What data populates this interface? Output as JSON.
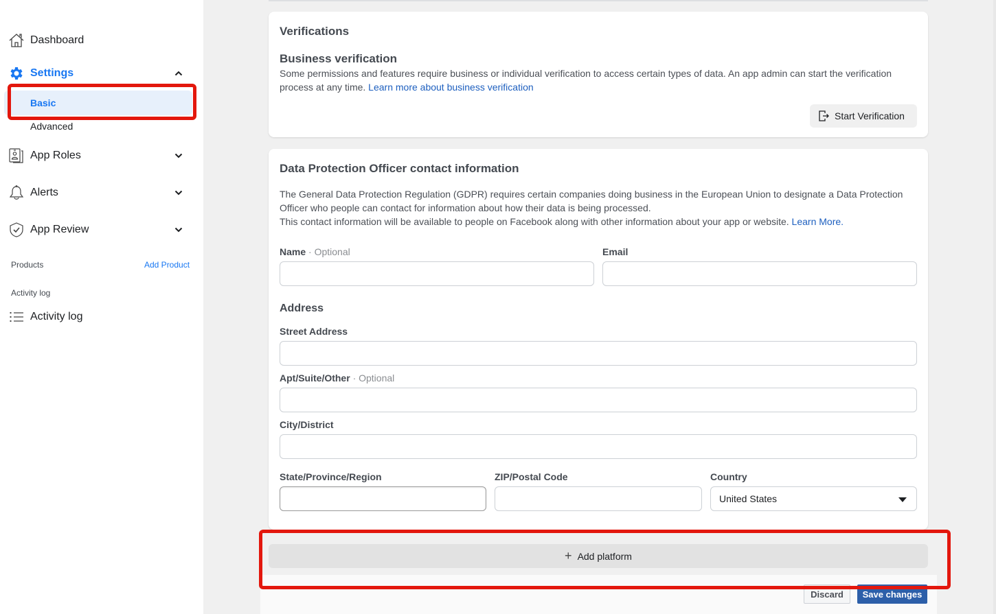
{
  "sidebar": {
    "dashboard": "Dashboard",
    "settings": "Settings",
    "settings_sub": [
      "Basic",
      "Advanced"
    ],
    "app_roles": "App Roles",
    "alerts": "Alerts",
    "app_review": "App Review",
    "products_label": "Products",
    "add_product": "Add Product",
    "activity_section": "Activity log",
    "activity_item": "Activity log"
  },
  "verifications": {
    "title": "Verifications",
    "subtitle": "Business verification",
    "description": "Some permissions and features require business or individual verification to access certain types of data. An app admin can start the verification process at any time.",
    "link": "Learn more about business verification",
    "button": "Start Verification"
  },
  "dpo": {
    "title": "Data Protection Officer contact information",
    "desc_line1": "The General Data Protection Regulation (GDPR) requires certain companies doing business in the European Union to designate a Data Protection Officer who people can contact for information about how their data is being processed.",
    "desc_line2": "This contact information will be available to people on Facebook along with other information about your app or website.",
    "learn_more": "Learn More.",
    "name_label": "Name",
    "optional": "· Optional",
    "email_label": "Email",
    "address_heading": "Address",
    "street_label": "Street Address",
    "apt_label": "Apt/Suite/Other",
    "city_label": "City/District",
    "state_label": "State/Province/Region",
    "zip_label": "ZIP/Postal Code",
    "country_label": "Country",
    "country_value": "United States",
    "name_value": "",
    "email_value": "",
    "street_value": "",
    "apt_value": "",
    "city_value": "",
    "state_value": "",
    "zip_value": ""
  },
  "actions": {
    "add_platform": "Add platform",
    "discard": "Discard",
    "save": "Save changes"
  },
  "colors": {
    "accent": "#1877f2",
    "link": "#1d5fbf",
    "save_button": "#2d5fa9",
    "annotation": "#e3170d"
  }
}
